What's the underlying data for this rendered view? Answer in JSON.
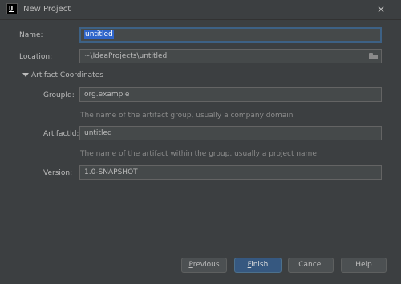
{
  "window": {
    "title": "New Project"
  },
  "form": {
    "name": {
      "label": "Name:",
      "value": "untitled"
    },
    "location": {
      "label": "Location:",
      "value": "~\\IdeaProjects\\untitled"
    },
    "section_title": "Artifact Coordinates",
    "group_id": {
      "label": "GroupId:",
      "value": "org.example",
      "hint": "The name of the artifact group, usually a company domain"
    },
    "artifact_id": {
      "label": "ArtifactId:",
      "value": "untitled",
      "hint": "The name of the artifact within the group, usually a project name"
    },
    "version": {
      "label": "Version:",
      "value": "1.0-SNAPSHOT"
    }
  },
  "buttons": {
    "previous": {
      "mnemonic": "P",
      "rest": "revious"
    },
    "finish": {
      "mnemonic": "F",
      "rest": "inish"
    },
    "cancel": "Cancel",
    "help": "Help"
  },
  "icons": {
    "app": "intellij-logo-icon",
    "close": "close-icon",
    "browse": "folder-icon",
    "section": "triangle-down-icon"
  },
  "colors": {
    "background": "#3c3f41",
    "field": "#45494a",
    "focus_border": "#3d6185",
    "selection": "#2f65ca",
    "default_button": "#365880"
  }
}
